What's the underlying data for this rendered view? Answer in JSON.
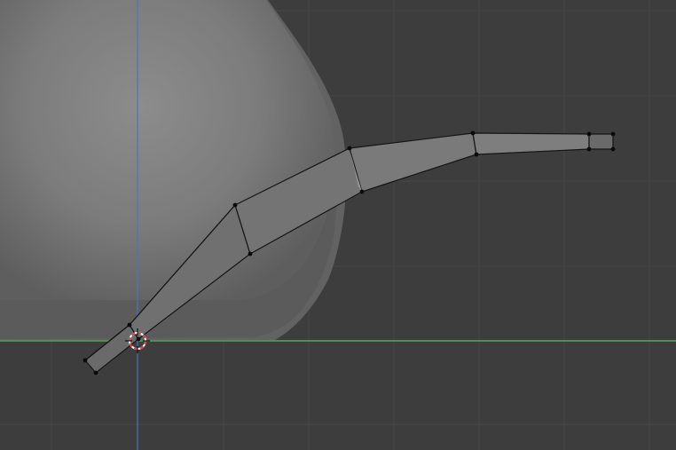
{
  "viewport": {
    "background": "#3d3d3d",
    "grid_color": "#4a4a4a",
    "x_axis_color": "#5fa45f",
    "y_axis_color": "#4a76b8",
    "cursor_colors": [
      "#d9413a",
      "#ffffff"
    ],
    "mesh_fill": "#6e6e6e",
    "mesh_edge": "#151515",
    "vertex_color": "#0a0a0a"
  },
  "objects": {
    "background_mesh": "teapot-body",
    "active_mesh": "teapot-spout"
  }
}
